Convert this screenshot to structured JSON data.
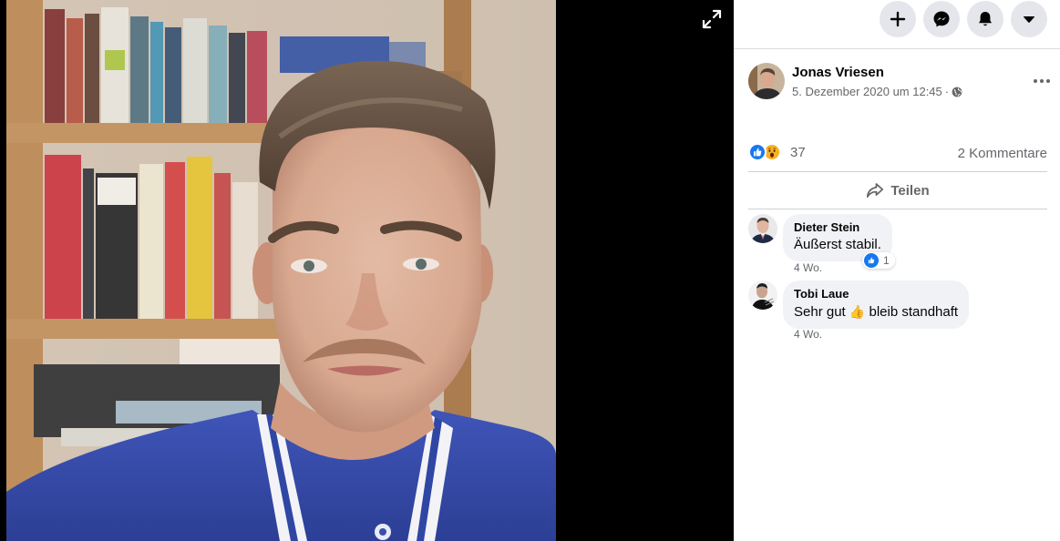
{
  "viewer": {
    "photo_alt": "",
    "expand_icon": "expand-icon"
  },
  "topbar": {
    "buttons": [
      {
        "name": "create",
        "icon": "plus-icon"
      },
      {
        "name": "messenger",
        "icon": "messenger-icon"
      },
      {
        "name": "notifications",
        "icon": "bell-icon"
      },
      {
        "name": "account",
        "icon": "caret-down-icon"
      }
    ]
  },
  "post": {
    "author": "Jonas Vriesen",
    "date": "5. Dezember 2020 um 12:45",
    "separator": "·",
    "privacy_icon": "globe-icon",
    "reaction_count": "37",
    "comment_count": "2 Kommentare",
    "share_label": "Teilen"
  },
  "comments": [
    {
      "author": "Dieter Stein",
      "text": "Äußerst stabil.",
      "time": "4 Wo.",
      "likes": "1"
    },
    {
      "author": "Tobi Laue",
      "text_before": "Sehr gut",
      "emoji": "👍",
      "text_after": "bleib standhaft",
      "time": "4 Wo."
    }
  ],
  "colors": {
    "accent": "#1877f2",
    "secondary_text": "#65676b",
    "bubble": "#f0f2f5",
    "button_bg": "#e4e6eb"
  }
}
